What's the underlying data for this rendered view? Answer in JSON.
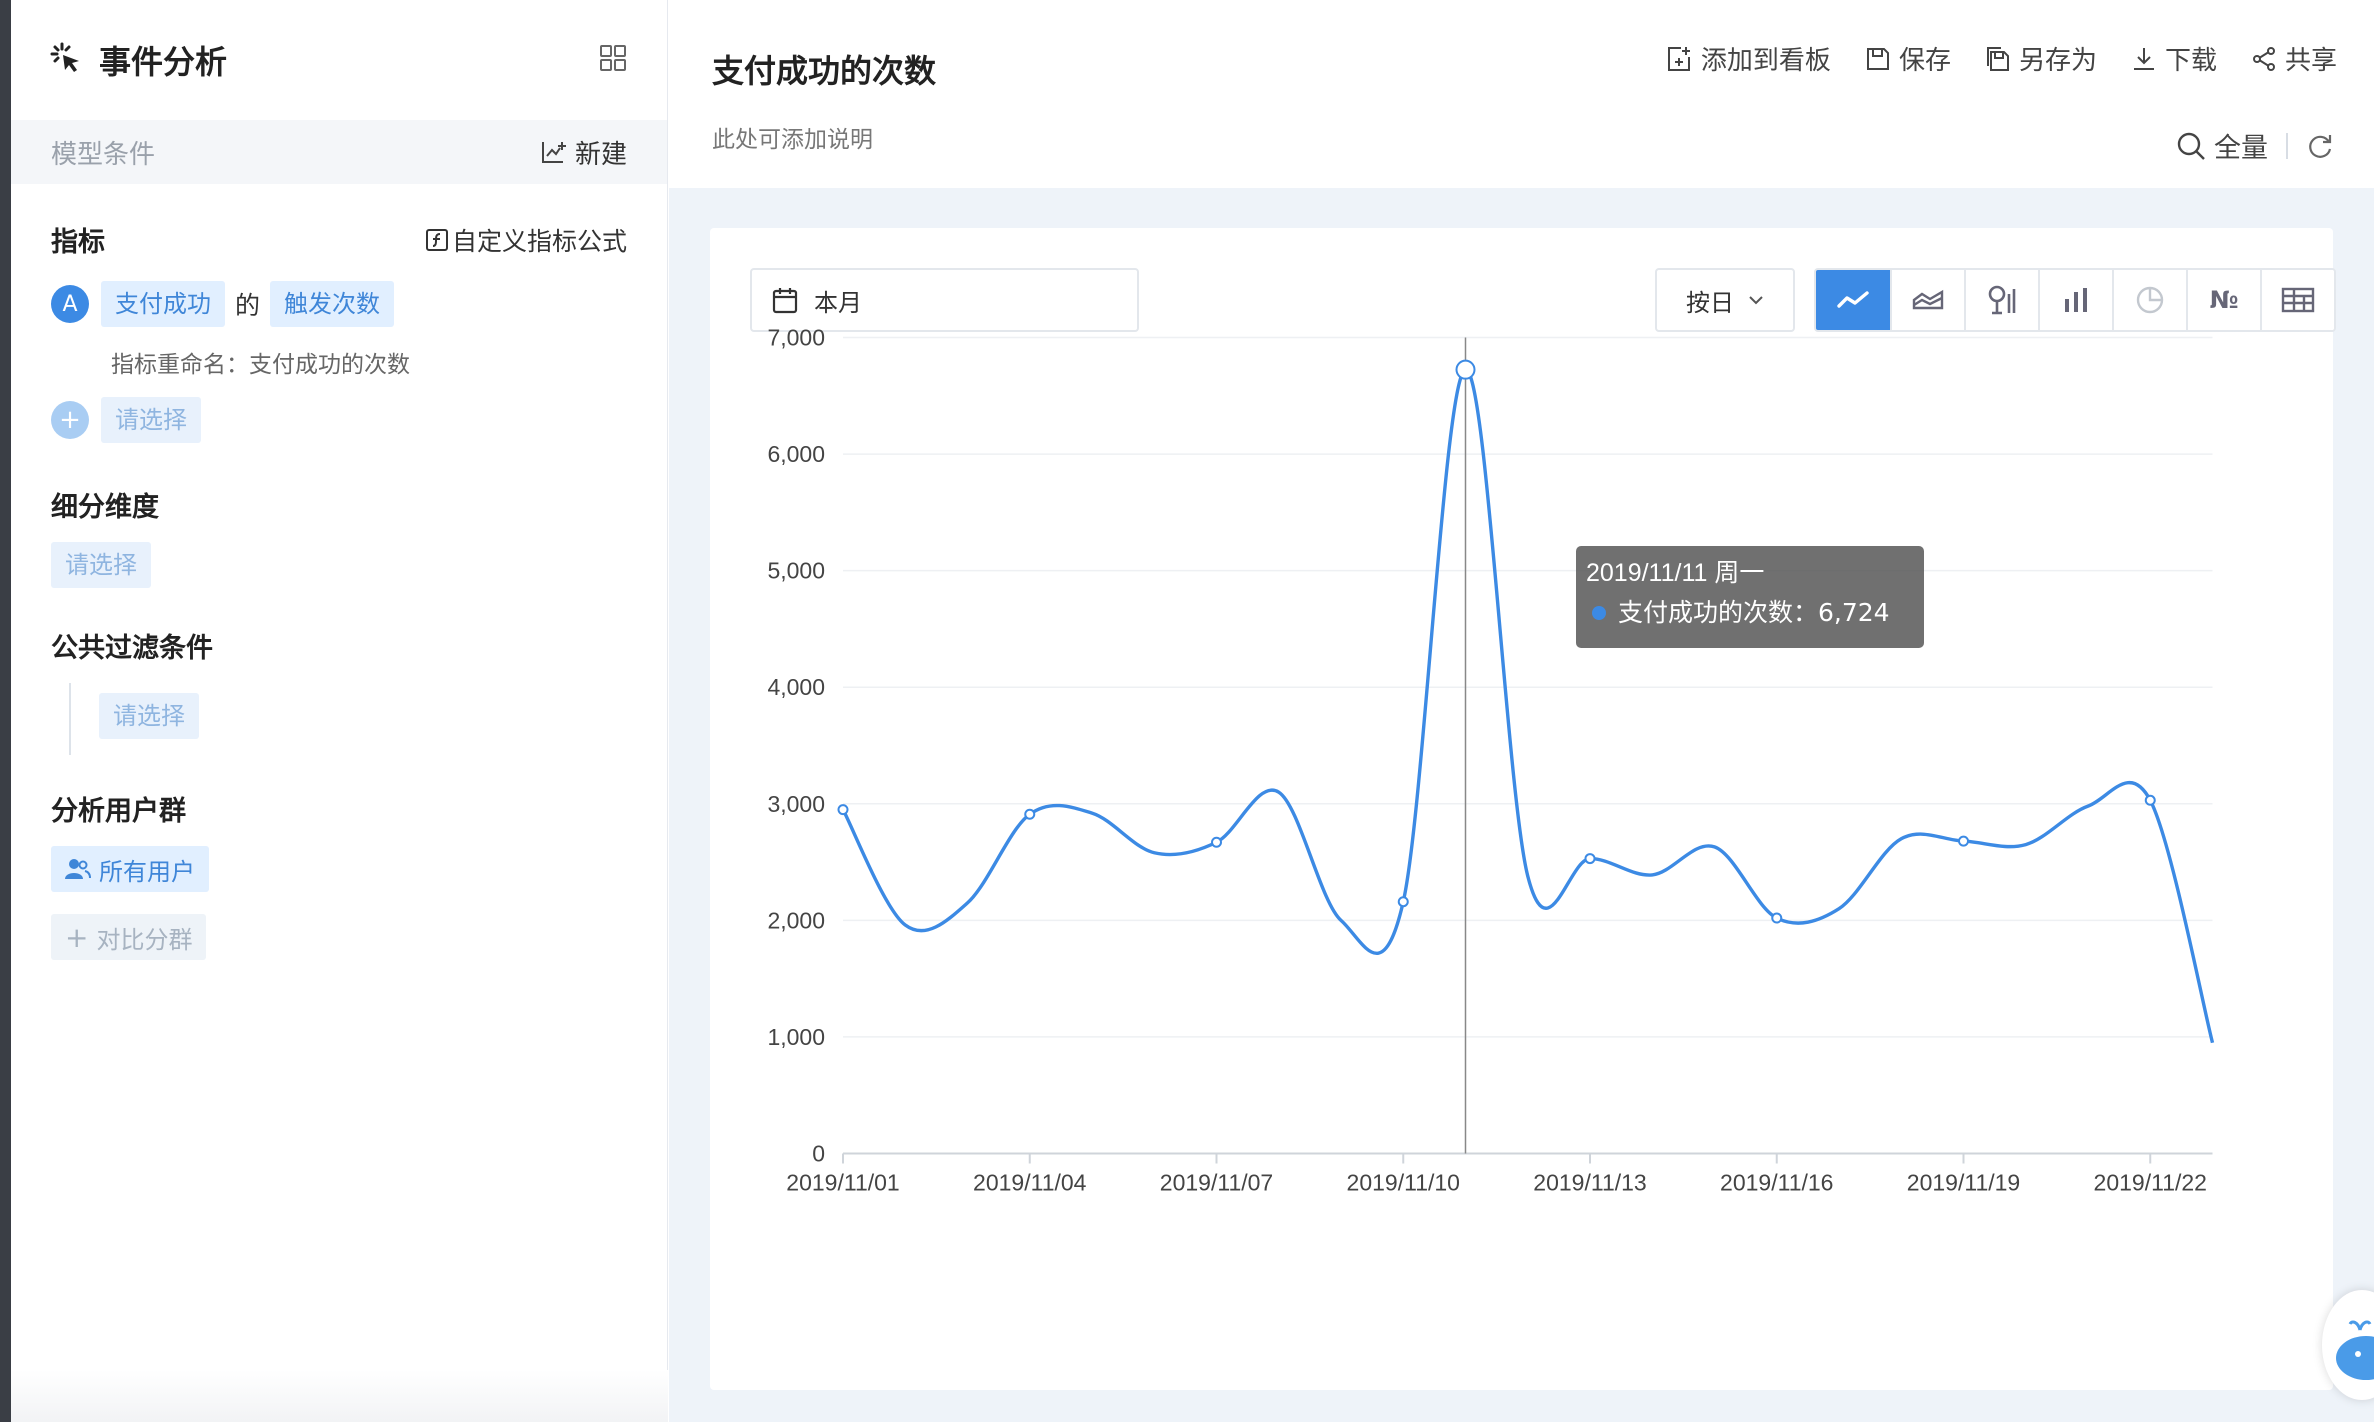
{
  "sidebar": {
    "title": "事件分析",
    "model_label": "模型条件",
    "new_label": "新建",
    "metrics": {
      "title": "指标",
      "custom_formula": "自定义指标公式",
      "item": {
        "badge": "A",
        "event": "支付成功",
        "of": "的",
        "measure": "触发次数",
        "rename": "指标重命名：支付成功的次数"
      },
      "add_placeholder": "请选择"
    },
    "dimension": {
      "title": "细分维度",
      "placeholder": "请选择"
    },
    "filter": {
      "title": "公共过滤条件",
      "placeholder": "请选择"
    },
    "users": {
      "title": "分析用户群",
      "all_users": "所有用户",
      "compare": "对比分群"
    }
  },
  "header": {
    "title": "支付成功的次数",
    "description": "此处可添加说明",
    "toolbar": [
      "添加到看板",
      "保存",
      "另存为",
      "下载",
      "共享"
    ],
    "scope": "全量"
  },
  "controls": {
    "date_range": "本月",
    "granularity": "按日",
    "chart_types": [
      "line-chart-icon",
      "area-chart-icon",
      "rank-chart-icon",
      "bar-chart-icon",
      "pie-chart-icon",
      "number-icon",
      "table-icon"
    ],
    "number_glyph": "№",
    "active_chart_type": "line"
  },
  "tooltip": {
    "date": "2019/11/11 周一",
    "series": "支付成功的次数：",
    "value": "6,724"
  },
  "chart_data": {
    "type": "line",
    "title": "",
    "xlabel": "",
    "ylabel": "",
    "ylim": [
      0,
      7000
    ],
    "yticks": [
      "0",
      "1,000",
      "2,000",
      "3,000",
      "4,000",
      "5,000",
      "6,000",
      "7,000"
    ],
    "ytick_values": [
      0,
      1000,
      2000,
      3000,
      4000,
      5000,
      6000,
      7000
    ],
    "x": [
      "2019/11/01",
      "2019/11/02",
      "2019/11/03",
      "2019/11/04",
      "2019/11/05",
      "2019/11/06",
      "2019/11/07",
      "2019/11/08",
      "2019/11/09",
      "2019/11/10",
      "2019/11/11",
      "2019/11/12",
      "2019/11/13",
      "2019/11/14",
      "2019/11/15",
      "2019/11/16",
      "2019/11/17",
      "2019/11/18",
      "2019/11/19",
      "2019/11/20",
      "2019/11/21",
      "2019/11/22",
      "2019/11/23"
    ],
    "xtick_labels": [
      "2019/11/01",
      "2019/11/04",
      "2019/11/07",
      "2019/11/10",
      "2019/11/13",
      "2019/11/16",
      "2019/11/19",
      "2019/11/22"
    ],
    "series": [
      {
        "name": "支付成功的次数",
        "color": "#3c8ae4",
        "values": [
          2950,
          1960,
          2150,
          2910,
          2920,
          2580,
          2670,
          3100,
          2000,
          2160,
          6724,
          2380,
          2530,
          2390,
          2630,
          2020,
          2100,
          2700,
          2680,
          2650,
          2980,
          3030,
          950
        ]
      }
    ],
    "grid": true,
    "legend": "none"
  }
}
